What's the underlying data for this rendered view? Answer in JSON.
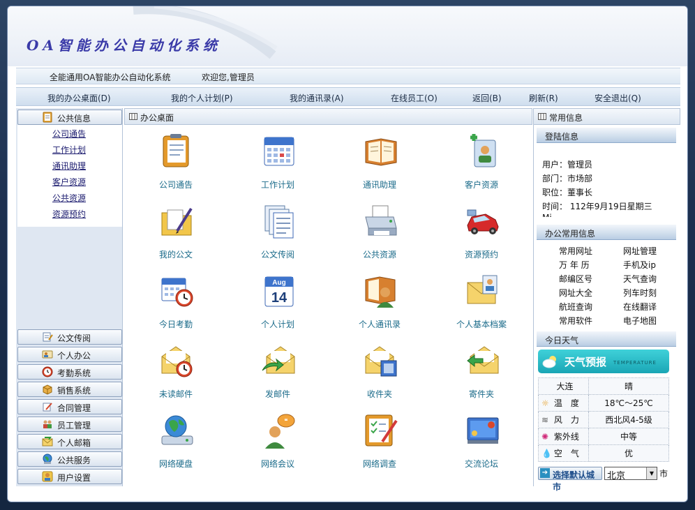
{
  "app": {
    "title": "OA智能办公自动化系统"
  },
  "topbar": {
    "system_name": "全能通用OA智能办公自动化系统",
    "welcome": "欢迎您,管理员"
  },
  "nav": {
    "items": [
      {
        "label": "我的办公桌面(D)"
      },
      {
        "label": "我的个人计划(P)"
      },
      {
        "label": "我的通讯录(A)"
      },
      {
        "label": "在线员工(O)"
      },
      {
        "label": "返回(B)"
      },
      {
        "label": "刷新(R)"
      },
      {
        "label": "安全退出(Q)"
      }
    ]
  },
  "sidebar": {
    "public_info": {
      "label": "公共信息",
      "links": [
        {
          "label": "公司通告"
        },
        {
          "label": "工作计划"
        },
        {
          "label": "通讯助理"
        },
        {
          "label": "客户资源"
        },
        {
          "label": "公共资源"
        },
        {
          "label": "资源预约"
        }
      ]
    },
    "groups": [
      {
        "label": "公文传阅",
        "icon": "document-pen-icon"
      },
      {
        "label": "个人办公",
        "icon": "person-card-icon"
      },
      {
        "label": "考勤系统",
        "icon": "clock-icon"
      },
      {
        "label": "销售系统",
        "icon": "box-icon"
      },
      {
        "label": "合同管理",
        "icon": "contract-pen-icon"
      },
      {
        "label": "员工管理",
        "icon": "people-icon"
      },
      {
        "label": "个人邮箱",
        "icon": "mail-icon"
      },
      {
        "label": "公共服务",
        "icon": "globe-icon"
      },
      {
        "label": "用户设置",
        "icon": "user-settings-icon"
      }
    ]
  },
  "main": {
    "header": "办公桌面",
    "tiles": [
      {
        "label": "公司通告",
        "icon": "notepad-icon"
      },
      {
        "label": "工作计划",
        "icon": "calendar-icon"
      },
      {
        "label": "通讯助理",
        "icon": "address-book-icon"
      },
      {
        "label": "客户资源",
        "icon": "customer-card-icon"
      },
      {
        "label": "我的公文",
        "icon": "folder-pen-icon"
      },
      {
        "label": "公文传阅",
        "icon": "documents-icon"
      },
      {
        "label": "公共资源",
        "icon": "printer-icon"
      },
      {
        "label": "资源预约",
        "icon": "car-icon"
      },
      {
        "label": "今日考勤",
        "icon": "calendar-clock-icon"
      },
      {
        "label": "个人计划",
        "icon": "calendar-aug-icon"
      },
      {
        "label": "个人通讯录",
        "icon": "book-person-icon"
      },
      {
        "label": "个人基本档案",
        "icon": "envelope-person-icon"
      },
      {
        "label": "未读邮件",
        "icon": "mail-clock-icon"
      },
      {
        "label": "发邮件",
        "icon": "mail-send-icon"
      },
      {
        "label": "收件夹",
        "icon": "mail-inbox-icon"
      },
      {
        "label": "寄件夹",
        "icon": "mail-outbox-icon"
      },
      {
        "label": "网络硬盘",
        "icon": "globe-drive-icon"
      },
      {
        "label": "网络会议",
        "icon": "chat-person-icon"
      },
      {
        "label": "网络调查",
        "icon": "checklist-icon"
      },
      {
        "label": "交流论坛",
        "icon": "forum-board-icon"
      }
    ],
    "aug_text": "Aug",
    "aug_day": "14"
  },
  "right": {
    "header": "常用信息",
    "login": {
      "title": "登陆信息",
      "user": "用户：管理员",
      "dept": "部门：市场部",
      "position": "职位：董事长",
      "time": "时间： 112年9月19日星期三",
      "extra": "Mi"
    },
    "office": {
      "title": "办公常用信息",
      "links": [
        {
          "label": "常用网址"
        },
        {
          "label": "网址管理"
        },
        {
          "label": "万 年 历"
        },
        {
          "label": "手机及ip"
        },
        {
          "label": "邮编区号"
        },
        {
          "label": "天气查询"
        },
        {
          "label": "网址大全"
        },
        {
          "label": "列车时刻"
        },
        {
          "label": "航班查询"
        },
        {
          "label": "在线翻译"
        },
        {
          "label": "常用软件"
        },
        {
          "label": "电子地图"
        }
      ]
    },
    "weather": {
      "title": "今日天气",
      "banner": "天气预报",
      "banner_sub": "TEMPERATURE",
      "city": "大连",
      "condition": "晴",
      "rows": [
        {
          "key": "温　度",
          "icon": "sun-icon",
          "value": "18℃～25℃"
        },
        {
          "key": "风　力",
          "icon": "wind-icon",
          "value": "西北风4-5级"
        },
        {
          "key": "紫外线",
          "icon": "uv-icon",
          "value": "中等"
        },
        {
          "key": "空　气",
          "icon": "air-icon",
          "value": "优"
        }
      ],
      "select_city_label": "选择默认城市",
      "selected_city": "北京",
      "suffix": "市"
    }
  },
  "colors": {
    "accent": "#3a3aa8",
    "tile_label": "#1b6b8a",
    "weather_banner": "#1aa6b5"
  }
}
